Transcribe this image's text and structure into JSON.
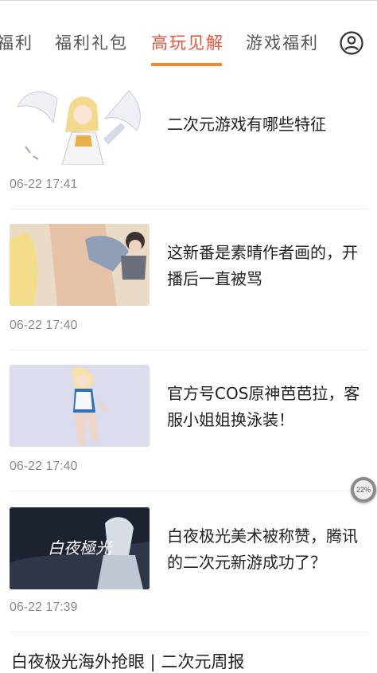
{
  "tabs": [
    {
      "label": "福利"
    },
    {
      "label": "福利礼包"
    },
    {
      "label": "高玩见解",
      "active": true
    },
    {
      "label": "游戏福利"
    }
  ],
  "articles": [
    {
      "title": "二次元游戏有哪些特征",
      "time": "06-22 17:41",
      "thumb": "angel-anime-character"
    },
    {
      "title": "这新番是素晴作者画的，开播后一直被骂",
      "time": "06-22 17:40",
      "thumb": "anime-scene"
    },
    {
      "title": "官方号COS原神芭芭拉，客服小姐姐换泳装！",
      "time": "06-22 17:40",
      "thumb": "cosplay-photo"
    },
    {
      "title": "白夜极光美术被称赞，腾讯的二次元新游成功了？",
      "time": "06-22 17:39",
      "thumb": "game-banner",
      "thumb_text": "白夜極光"
    }
  ],
  "partial_article_title": "白夜极光海外抢眼 | 二次元周报",
  "float_badge": "22%",
  "colors": {
    "accent": "#e6563f",
    "underline": "#f08a2c"
  }
}
